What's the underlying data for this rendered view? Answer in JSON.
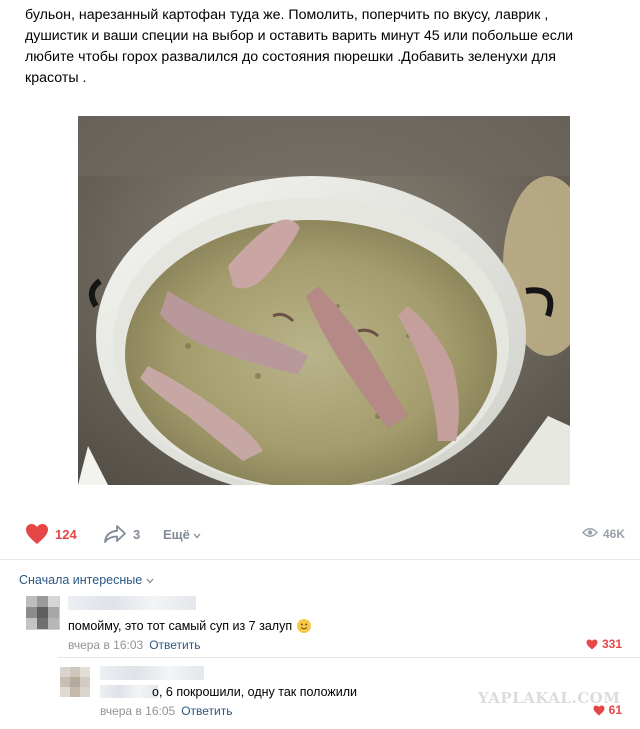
{
  "post": {
    "text_lines": [
      "бульон, нарезанный картофан туда же. Помолить, поперчить по вкусу, лаврик ,",
      "душистик и ваши специи на выбор и оставить варить минут 45 или побольше если",
      "любите чтобы горох развалился до состояния пюрешки .Добавить зеленухи для",
      "красоты ."
    ]
  },
  "actions": {
    "likes": "124",
    "shares": "3",
    "more_label": "Ещё",
    "views": "46K"
  },
  "comments_header": {
    "sort_label": "Сначала интересные"
  },
  "comments": [
    {
      "text": "помойму, это тот самый суп из 7 залуп",
      "time": "вчера в 16:03",
      "reply_label": "Ответить",
      "likes": "331"
    },
    {
      "text": "о, 6 покрошили, одну так положили",
      "time": "вчера в 16:05",
      "reply_label": "Ответить",
      "likes": "61"
    }
  ],
  "watermark": "YAPLAKAL.COM",
  "colors": {
    "like_red": "#e64646",
    "link_blue": "#2a5885",
    "muted": "#828a99"
  }
}
